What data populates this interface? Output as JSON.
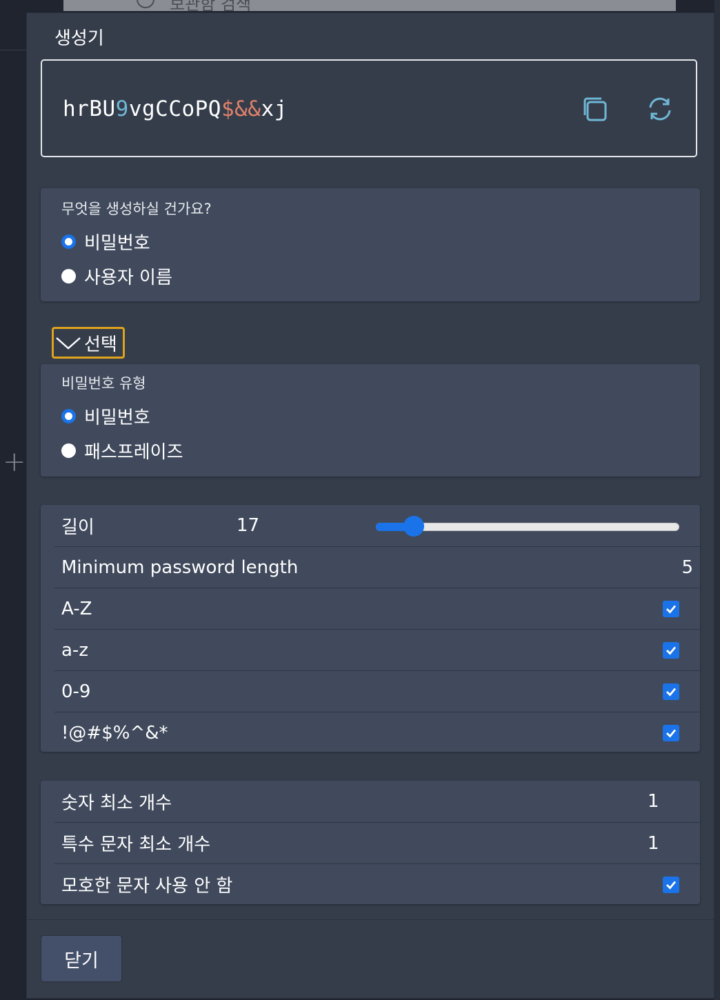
{
  "background": {
    "search_placeholder": "보관함 검색"
  },
  "dialog": {
    "title": "생성기",
    "close_label": "닫기"
  },
  "generated": {
    "segments": [
      {
        "text": "hrBU",
        "kind": "letter"
      },
      {
        "text": "9",
        "kind": "number"
      },
      {
        "text": "vgCCoPQ",
        "kind": "letter"
      },
      {
        "text": "$&&",
        "kind": "special"
      },
      {
        "text": "xj",
        "kind": "letter"
      }
    ],
    "copy_icon": "copy-icon",
    "regenerate_icon": "refresh-icon"
  },
  "type_section": {
    "legend": "무엇을 생성하실 건가요?",
    "options": [
      {
        "label": "비밀번호",
        "selected": true
      },
      {
        "label": "사용자 이름",
        "selected": false
      }
    ]
  },
  "options_toggle": {
    "label": "선택",
    "icon": "chevron-down-icon"
  },
  "password_type": {
    "legend": "비밀번호 유형",
    "options": [
      {
        "label": "비밀번호",
        "selected": true
      },
      {
        "label": "패스프레이즈",
        "selected": false
      }
    ]
  },
  "settings": {
    "length_label": "길이",
    "length_value": "17",
    "length_fraction": 0.125,
    "min_length_label": "Minimum password length",
    "min_length_value": "5",
    "checks": [
      {
        "label": "A-Z",
        "checked": true
      },
      {
        "label": "a-z",
        "checked": true
      },
      {
        "label": "0-9",
        "checked": true
      },
      {
        "label": "!@#$%^&*",
        "checked": true
      }
    ]
  },
  "minimums": {
    "min_numbers_label": "숫자 최소 개수",
    "min_numbers_value": "1",
    "min_special_label": "특수 문자 최소 개수",
    "min_special_value": "1",
    "avoid_ambiguous_label": "모호한 문자 사용 안 함",
    "avoid_ambiguous_checked": true
  },
  "colors": {
    "accent": "#1a73e8",
    "focus": "#e0a31c",
    "number": "#6fb8d6",
    "special": "#e0816a"
  }
}
